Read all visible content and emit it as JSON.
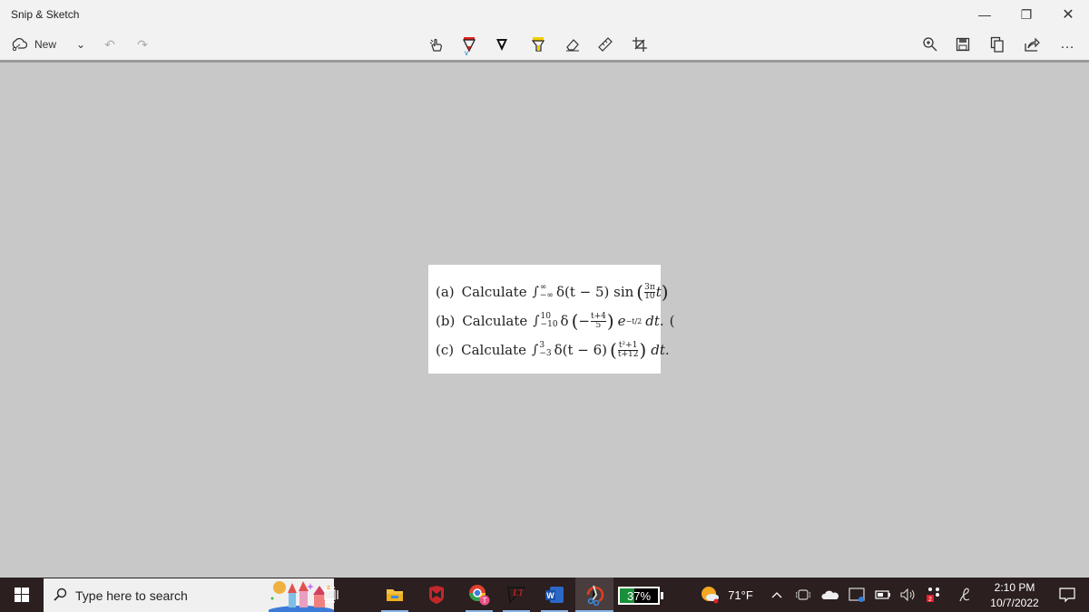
{
  "window": {
    "title": "Snip & Sketch",
    "controls": {
      "minimize": "—",
      "maximize": "❐",
      "close": "✕"
    }
  },
  "toolbar": {
    "new_label": "New",
    "new_dropdown": "⌄",
    "undo": "↶",
    "redo": "↷",
    "tools": [
      {
        "name": "touch-writing",
        "glyph": "☝"
      },
      {
        "name": "ballpoint-pen",
        "color": "#e02020"
      },
      {
        "name": "pencil",
        "color": "#111111"
      },
      {
        "name": "highlighter",
        "color": "#f0d000"
      },
      {
        "name": "eraser",
        "glyph": "⌫"
      },
      {
        "name": "ruler",
        "glyph": "📏"
      },
      {
        "name": "crop",
        "glyph": "⌗"
      }
    ],
    "active_tool_index": 1,
    "accent": "#1a6fd1",
    "right": {
      "zoom": "⊕",
      "save": "💾",
      "copy": "⧉",
      "share": "⇪",
      "more": "…"
    }
  },
  "snip": {
    "lines": [
      {
        "label": "(a)",
        "word": "Calculate",
        "upper": "∞",
        "lower": "−∞",
        "body1": "δ(t − 5) sin",
        "frac_num": "3π",
        "frac_den": "10",
        "after_frac": "t"
      },
      {
        "label": "(b)",
        "word": "Calculate",
        "upper": "10",
        "lower": "−10",
        "body1": "δ",
        "frac_pre": "−",
        "frac_num": "t+4",
        "frac_den": "5",
        "exp_base": "e",
        "exp": "−t/2",
        "tail": "dt."
      },
      {
        "label": "(c)",
        "word": "Calculate",
        "upper": "3",
        "lower": "−3",
        "body1": "δ(t − 6)",
        "frac_num": "t²+1",
        "frac_den": "t+12",
        "tail": "dt."
      }
    ]
  },
  "taskbar": {
    "search_placeholder": "Type here to search",
    "apps": [
      "task-view",
      "file-explorer",
      "mcafee",
      "chrome",
      "app-lt",
      "word",
      "snip-sketch"
    ],
    "word_glyph": "W",
    "battery_percent": 37,
    "battery_text": "37%",
    "weather_temp": "71°F",
    "notification_badge": "2",
    "time": "2:10 PM",
    "date": "10/7/2022"
  }
}
